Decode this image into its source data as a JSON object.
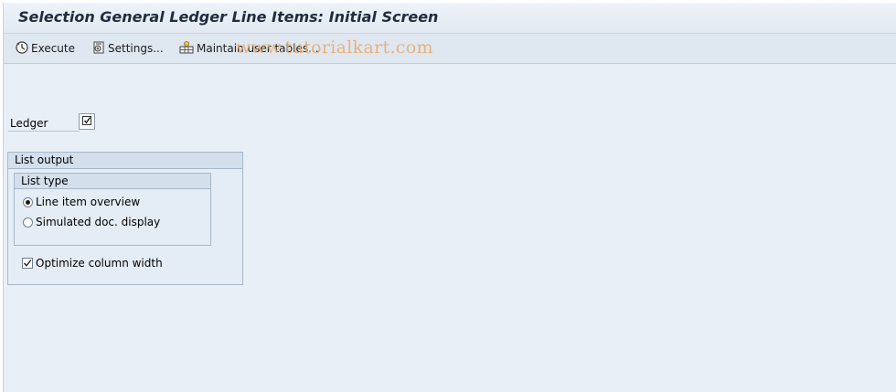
{
  "window": {
    "title": "Selection General Ledger Line Items: Initial Screen"
  },
  "toolbar": {
    "execute_label": "Execute",
    "settings_label": "Settings...",
    "maintain_label": "Maintain user tables..."
  },
  "watermark": "www.tutorialkart.com",
  "ledger": {
    "label": "Ledger",
    "checked": true
  },
  "list_output": {
    "title": "List output",
    "list_type": {
      "title": "List type",
      "options": [
        {
          "label": "Line item overview",
          "selected": true
        },
        {
          "label": "Simulated doc. display",
          "selected": false
        }
      ]
    },
    "optimize": {
      "label": "Optimize column width",
      "checked": true
    }
  }
}
